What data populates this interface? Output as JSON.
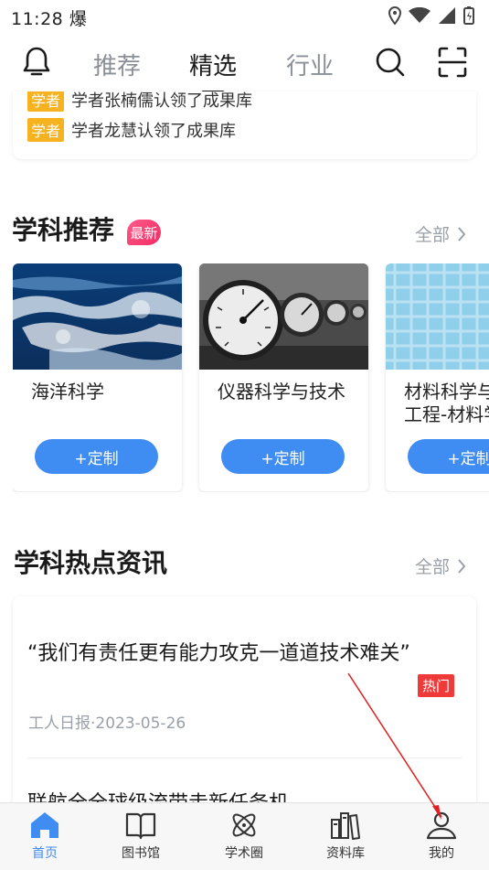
{
  "status": {
    "time": "11:28",
    "carrier_glyph": "爆"
  },
  "nav": {
    "tabs": [
      {
        "label": "推荐"
      },
      {
        "label": "精选"
      },
      {
        "label": "行业"
      }
    ],
    "active_tab": "精选"
  },
  "announcements": [
    {
      "badge": "学者",
      "text": "学者张楠儒认领了成果库"
    },
    {
      "badge": "学者",
      "text": "学者龙慧认领了成果库"
    }
  ],
  "subjects_section": {
    "title": "学科推荐",
    "badge": "最新",
    "see_all": "全部",
    "cards": [
      {
        "name": "海洋科学",
        "button": "+定制",
        "image": "ocean-waves"
      },
      {
        "name": "仪器科学与技术",
        "button": "+定制",
        "image": "pressure-gauges"
      },
      {
        "name": "材料科学与工程-材料学",
        "button": "+定制",
        "image": "material-texture"
      }
    ]
  },
  "news_section": {
    "title": "学科热点资讯",
    "see_all": "全部",
    "items": [
      {
        "title": "“我们有责任更有能力攻克一道道技术难关”",
        "badge": "热门",
        "meta": "工人日报·2023-05-26"
      },
      {
        "title": "联航全全球级流带走新任务机"
      }
    ]
  },
  "bottom_tabs": [
    {
      "label": "首页",
      "icon": "home-icon",
      "active": true
    },
    {
      "label": "图书馆",
      "icon": "book-icon",
      "active": false
    },
    {
      "label": "学术圈",
      "icon": "atom-icon",
      "active": false
    },
    {
      "label": "资料库",
      "icon": "library-icon",
      "active": false
    },
    {
      "label": "我的",
      "icon": "user-icon",
      "active": false
    }
  ],
  "colors": {
    "accent": "#3f8cf2",
    "badge_yellow": "#f6b21f",
    "hot_red": "#f03a3a",
    "new_pink": "#f02b63"
  }
}
